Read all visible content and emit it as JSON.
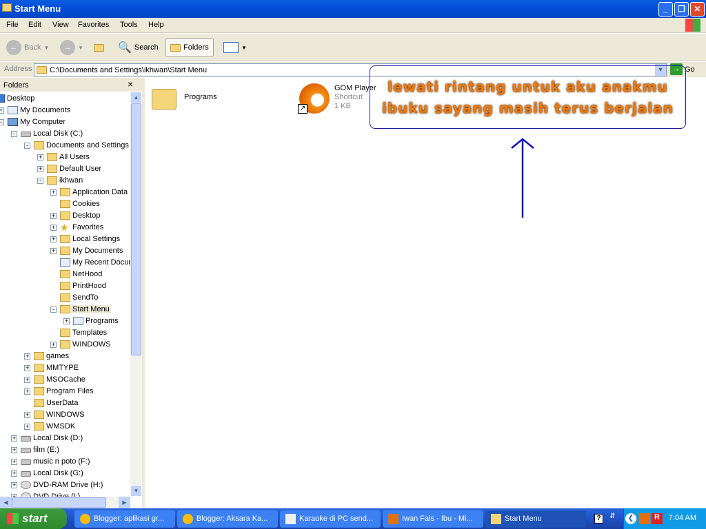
{
  "window": {
    "title": "Start Menu"
  },
  "menu": [
    "File",
    "Edit",
    "View",
    "Favorites",
    "Tools",
    "Help"
  ],
  "toolbar": {
    "back": "Back",
    "search": "Search",
    "folders": "Folders"
  },
  "address": {
    "label": "Address",
    "value": "C:\\Documents and Settings\\ikhwan\\Start Menu",
    "go": "Go"
  },
  "folders_pane": {
    "title": "Folders",
    "close": "×"
  },
  "tree": [
    {
      "label": "Desktop",
      "level": 0,
      "exp": "",
      "icon": "desk"
    },
    {
      "label": "My Documents",
      "level": 1,
      "exp": "+",
      "icon": "doc"
    },
    {
      "label": "My Computer",
      "level": 1,
      "exp": "-",
      "icon": "pc"
    },
    {
      "label": "Local Disk (C:)",
      "level": 2,
      "exp": "-",
      "icon": "drive"
    },
    {
      "label": "Documents and Settings",
      "level": 3,
      "exp": "-",
      "icon": "folder"
    },
    {
      "label": "All Users",
      "level": 4,
      "exp": "+",
      "icon": "folder"
    },
    {
      "label": "Default User",
      "level": 4,
      "exp": "+",
      "icon": "folder"
    },
    {
      "label": "ikhwan",
      "level": 4,
      "exp": "-",
      "icon": "folder"
    },
    {
      "label": "Application Data",
      "level": 5,
      "exp": "+",
      "icon": "folder"
    },
    {
      "label": "Cookies",
      "level": 5,
      "exp": "",
      "icon": "folder"
    },
    {
      "label": "Desktop",
      "level": 5,
      "exp": "+",
      "icon": "folder"
    },
    {
      "label": "Favorites",
      "level": 5,
      "exp": "+",
      "icon": "star"
    },
    {
      "label": "Local Settings",
      "level": 5,
      "exp": "+",
      "icon": "folder"
    },
    {
      "label": "My Documents",
      "level": 5,
      "exp": "+",
      "icon": "folder"
    },
    {
      "label": "My Recent Documents",
      "level": 5,
      "exp": "",
      "icon": "doc"
    },
    {
      "label": "NetHood",
      "level": 5,
      "exp": "",
      "icon": "folder"
    },
    {
      "label": "PrintHood",
      "level": 5,
      "exp": "",
      "icon": "folder"
    },
    {
      "label": "SendTo",
      "level": 5,
      "exp": "",
      "icon": "folder"
    },
    {
      "label": "Start Menu",
      "level": 5,
      "exp": "-",
      "icon": "folder",
      "selected": true
    },
    {
      "label": "Programs",
      "level": 6,
      "exp": "+",
      "icon": "doc"
    },
    {
      "label": "Templates",
      "level": 5,
      "exp": "",
      "icon": "folder"
    },
    {
      "label": "WINDOWS",
      "level": 5,
      "exp": "+",
      "icon": "folder"
    },
    {
      "label": "games",
      "level": 3,
      "exp": "+",
      "icon": "folder"
    },
    {
      "label": "MMTYPE",
      "level": 3,
      "exp": "+",
      "icon": "folder"
    },
    {
      "label": "MSOCache",
      "level": 3,
      "exp": "+",
      "icon": "folder"
    },
    {
      "label": "Program Files",
      "level": 3,
      "exp": "+",
      "icon": "folder"
    },
    {
      "label": "UserData",
      "level": 3,
      "exp": "",
      "icon": "folder"
    },
    {
      "label": "WINDOWS",
      "level": 3,
      "exp": "+",
      "icon": "folder"
    },
    {
      "label": "WMSDK",
      "level": 3,
      "exp": "+",
      "icon": "folder"
    },
    {
      "label": "Local Disk (D:)",
      "level": 2,
      "exp": "+",
      "icon": "drive"
    },
    {
      "label": "film (E:)",
      "level": 2,
      "exp": "+",
      "icon": "drive"
    },
    {
      "label": "music n poto (F:)",
      "level": 2,
      "exp": "+",
      "icon": "drive"
    },
    {
      "label": "Local Disk (G:)",
      "level": 2,
      "exp": "+",
      "icon": "drive"
    },
    {
      "label": "DVD-RAM Drive (H:)",
      "level": 2,
      "exp": "+",
      "icon": "cd"
    },
    {
      "label": "DVD Drive (I:)",
      "level": 2,
      "exp": "+",
      "icon": "cd"
    }
  ],
  "files": [
    {
      "name": "Programs",
      "type": "folder"
    },
    {
      "name": "GOM Player",
      "sub1": "Shortcut",
      "sub2": "1 KB",
      "type": "shortcut"
    }
  ],
  "banner": {
    "line1": "lewati rintang untuk aku anakmu",
    "line2": "ibuku sayang masih terus berjalan",
    "text_color": "#f07a10",
    "border_color": "#1a1a9a"
  },
  "taskbar": {
    "start": "start",
    "tasks": [
      "Blogger: aplikasi gr...",
      "Blogger: Aksara Ka...",
      "Karaoke di PC send...",
      "Iwan Fals - Ibu - Mi...",
      "Start Menu"
    ],
    "clock": "7:04 AM"
  }
}
